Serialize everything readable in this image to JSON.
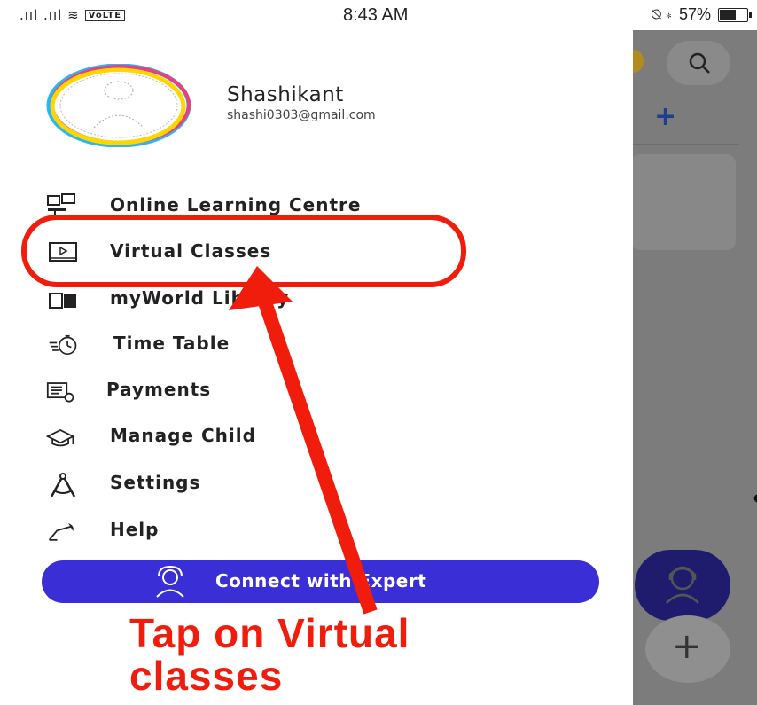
{
  "status_bar": {
    "signal": ".ııl .ııl ≋",
    "volte": "VoLTE",
    "time": "8:43 AM",
    "right_icons": "⍉ ∗",
    "battery": "57%",
    "battery_level": 0.57
  },
  "profile": {
    "name": "Shashikant",
    "email": "shashi0303@gmail.com"
  },
  "menu": {
    "items": [
      {
        "label": "Online Learning Centre",
        "icon": "monitor-classroom-icon"
      },
      {
        "label": "Virtual Classes",
        "icon": "video-play-icon"
      },
      {
        "label": "myWorld Library",
        "icon": "book-icon"
      },
      {
        "label": "Time Table",
        "icon": "stopwatch-icon"
      },
      {
        "label": "Payments",
        "icon": "receipt-icon"
      },
      {
        "label": "Manage Child",
        "icon": "graduation-cap-icon"
      },
      {
        "label": "Settings",
        "icon": "compass-icon"
      },
      {
        "label": "Help",
        "icon": "desk-lamp-icon"
      }
    ]
  },
  "connect_button": {
    "label": "Connect with Expert",
    "icon": "headset-agent-icon"
  },
  "annotation": {
    "line1": "Tap on Virtual",
    "line2": "classes",
    "color": "#f01d0d"
  },
  "background": {
    "plus_label": "+",
    "fab_plus": "+"
  },
  "colors": {
    "accent": "#3a2fd6",
    "annotation": "#f01d0d"
  }
}
